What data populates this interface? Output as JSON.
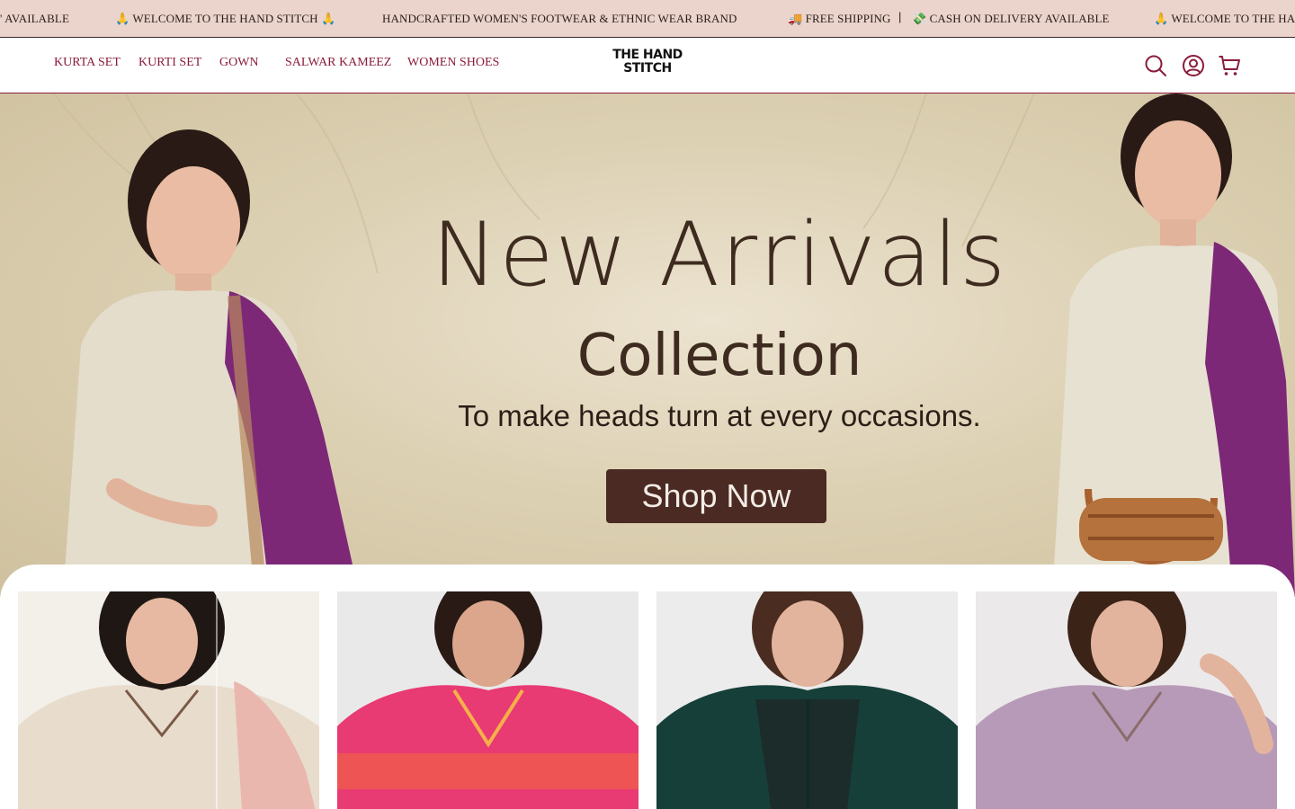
{
  "announcement": {
    "items": [
      "' AVAILABLE",
      "🙏 WELCOME TO THE HAND STITCH 🙏",
      "HANDCRAFTED WOMEN'S FOOTWEAR & ETHNIC WEAR BRAND",
      "🚚 FREE SHIPPING",
      "|",
      "💸 CASH ON DELIVERY AVAILABLE",
      "🙏 WELCOME TO THE HA"
    ]
  },
  "nav": {
    "links": [
      "KURTA SET",
      "KURTI SET",
      "GOWN",
      "SALWAR KAMEEZ",
      "WOMEN SHOES"
    ]
  },
  "logo": {
    "line1": "THE HAND",
    "line2": "STITCH"
  },
  "header_icons": [
    "search-icon",
    "account-icon",
    "cart-icon"
  ],
  "hero": {
    "title": "New Arrivals",
    "subtitle": "Collection",
    "tagline": "To make heads turn at every occasions.",
    "cta": "Shop Now"
  },
  "colors": {
    "accent": "#8a1c3a",
    "announcement_bg": "#ead4cb",
    "hero_bg": "#ddd1b4",
    "cta_bg": "#4a2a22"
  },
  "products": [
    {
      "outfit_color": "#e8dccd"
    },
    {
      "outfit_color": "#e83a73"
    },
    {
      "outfit_color": "#163f3a"
    },
    {
      "outfit_color": "#b79ab8"
    }
  ]
}
